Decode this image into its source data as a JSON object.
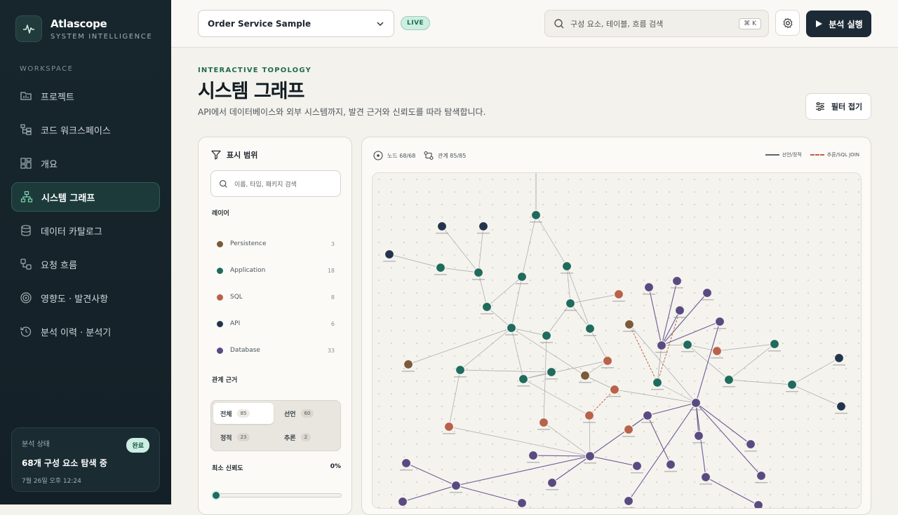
{
  "brand": {
    "name": "Atlascope",
    "subtitle": "SYSTEM INTELLIGENCE"
  },
  "sidebar": {
    "section_label": "WORKSPACE",
    "items": [
      {
        "label": "프로젝트",
        "icon": "folder-icon"
      },
      {
        "label": "코드 워크스페이스",
        "icon": "tree-icon"
      },
      {
        "label": "개요",
        "icon": "dashboard-icon"
      },
      {
        "label": "시스템 그래프",
        "icon": "graph-icon",
        "active": true
      },
      {
        "label": "데이터 카탈로그",
        "icon": "database-icon"
      },
      {
        "label": "요청 흐름",
        "icon": "flow-icon"
      },
      {
        "label": "영향도 · 발견사항",
        "icon": "target-icon"
      },
      {
        "label": "분석 이력 · 분석기",
        "icon": "history-icon"
      }
    ],
    "status": {
      "title": "분석 상태",
      "badge": "완료",
      "main": "68개 구성 요소 탐색 중",
      "time": "7월 26일 오후 12:24"
    }
  },
  "topbar": {
    "project": "Order Service Sample",
    "live": "LIVE",
    "search_placeholder": "구성 요소, 테이블, 흐름 검색",
    "shortcut": "⌘ K",
    "run_label": "분석 실행"
  },
  "header": {
    "eyebrow": "INTERACTIVE TOPOLOGY",
    "title": "시스템 그래프",
    "description": "API에서 데이터베이스와 외부 시스템까지, 발견 근거와 신뢰도를 따라 탐색합니다.",
    "filter_toggle": "필터 접기"
  },
  "filter_panel": {
    "title": "표시 범위",
    "search_placeholder": "이름, 타입, 패키지 검색",
    "layers_label": "레이어",
    "layers": [
      {
        "name": "Persistence",
        "count": "3",
        "color": "#7a5b3a"
      },
      {
        "name": "Application",
        "count": "18",
        "color": "#1f6b5d"
      },
      {
        "name": "SQL",
        "count": "8",
        "color": "#b9614a"
      },
      {
        "name": "API",
        "count": "6",
        "color": "#23344d"
      },
      {
        "name": "Database",
        "count": "33",
        "color": "#5a4a82"
      }
    ],
    "relation_label": "관계 근거",
    "relations": [
      {
        "label": "전체",
        "count": "85",
        "active": true
      },
      {
        "label": "선언",
        "count": "60"
      },
      {
        "label": "정적",
        "count": "23"
      },
      {
        "label": "추론",
        "count": "2"
      }
    ],
    "confidence_label": "최소 신뢰도",
    "confidence_value": "0%",
    "confidence": 0
  },
  "graph": {
    "nodes_stat": "노드 68/68",
    "edges_stat": "관계 85/85",
    "legend_declared": "선언/정적",
    "legend_inferred": "추론/SQL JOIN",
    "colors": {
      "persistence": "#7a5b3a",
      "application": "#1f6b5d",
      "sql": "#b9614a",
      "api": "#23344d",
      "database": "#5a4a82"
    }
  }
}
